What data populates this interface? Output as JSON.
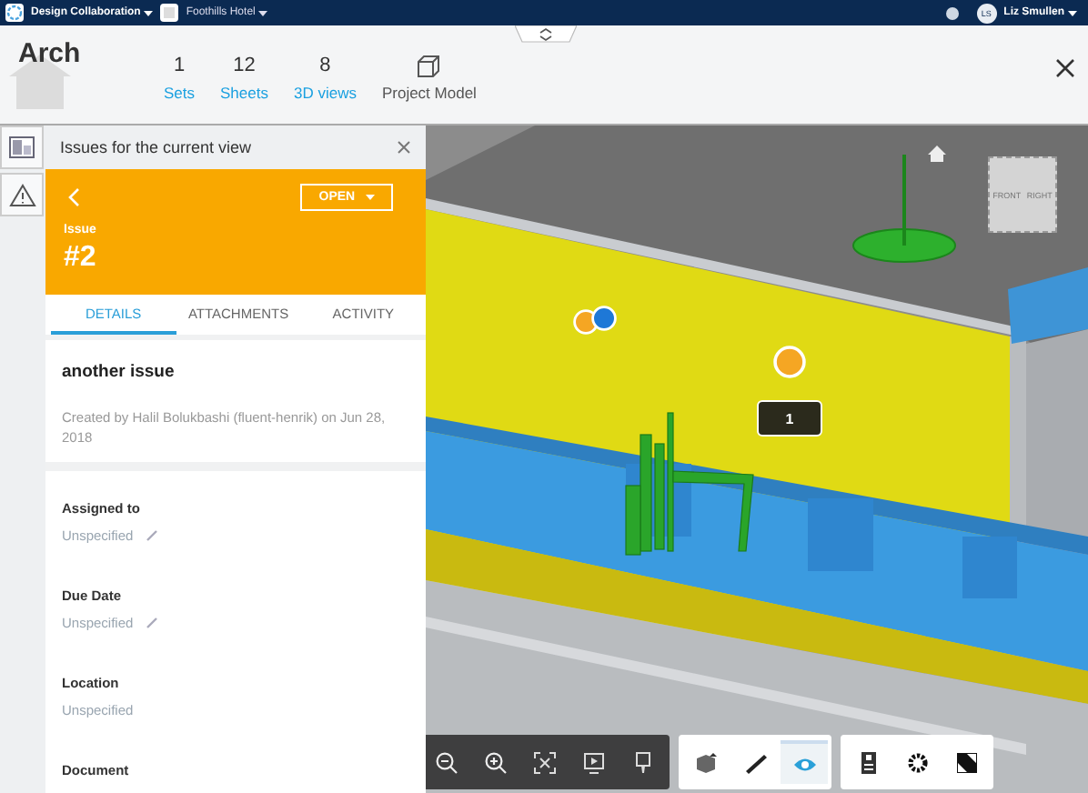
{
  "top_bar": {
    "app_menu": "Design Collaboration",
    "project_menu": "Foothills Hotel",
    "user": {
      "initials": "LS",
      "name": "Liz Smullen"
    }
  },
  "header": {
    "title": "Arch",
    "stats": [
      {
        "kind": "count",
        "value": "1",
        "label": "Sets"
      },
      {
        "kind": "count",
        "value": "12",
        "label": "Sheets"
      },
      {
        "kind": "count",
        "value": "8",
        "label": "3D views"
      },
      {
        "kind": "model",
        "label": "Project Model"
      }
    ]
  },
  "panel": {
    "title": "Issues for the current view",
    "issue": {
      "status": "OPEN",
      "label": "Issue",
      "number": "#2"
    },
    "tabs": [
      {
        "label": "DETAILS",
        "selected": true
      },
      {
        "label": "ATTACHMENTS",
        "selected": false
      },
      {
        "label": "ACTIVITY",
        "selected": false
      }
    ],
    "summary": "another issue",
    "created": "Created by Halil Bolukbashi (fluent-henrik) on Jun 28, 2018",
    "fields": [
      {
        "label": "Assigned to",
        "value": "Unspecified",
        "editable": true
      },
      {
        "label": "Due Date",
        "value": "Unspecified",
        "editable": true
      },
      {
        "label": "Location",
        "value": "Unspecified",
        "editable": false
      },
      {
        "label": "Document"
      }
    ]
  },
  "viewer": {
    "cube_faces": [
      "FRONT",
      "RIGHT"
    ],
    "markers": [
      {
        "color": "#f5a623"
      },
      {
        "color": "#1e78d7"
      },
      {
        "color": "#f5a623"
      }
    ],
    "tag": "1",
    "toolbar": [
      [
        {
          "kind": "zoom-out",
          "selected": false
        },
        {
          "kind": "zoom-in",
          "selected": false
        },
        {
          "kind": "fit",
          "selected": false
        },
        {
          "kind": "video",
          "selected": false
        },
        {
          "kind": "pin",
          "selected": false
        }
      ],
      [
        {
          "kind": "model",
          "selected": false
        },
        {
          "kind": "ruler",
          "selected": false
        },
        {
          "kind": "eye",
          "selected": true
        }
      ],
      [
        {
          "kind": "properties",
          "selected": false
        },
        {
          "kind": "settings",
          "selected": false
        },
        {
          "kind": "fullscreen",
          "selected": false
        }
      ]
    ]
  }
}
